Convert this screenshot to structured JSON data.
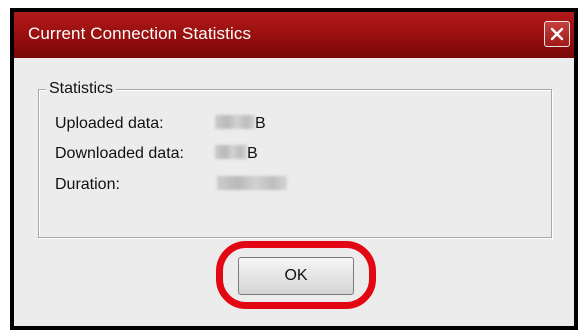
{
  "window": {
    "title": "Current Connection Statistics",
    "close_icon": "close-icon",
    "titlebar_color": "#9c1010"
  },
  "statistics": {
    "group_label": "Statistics",
    "rows": [
      {
        "label": "Uploaded data:",
        "unit": "B"
      },
      {
        "label": "Downloaded data:",
        "unit": "B"
      },
      {
        "label": "Duration:",
        "unit": ""
      }
    ]
  },
  "buttons": {
    "ok_label": "OK"
  },
  "annotation": {
    "highlight_color": "#e30613",
    "target": "ok-button"
  }
}
